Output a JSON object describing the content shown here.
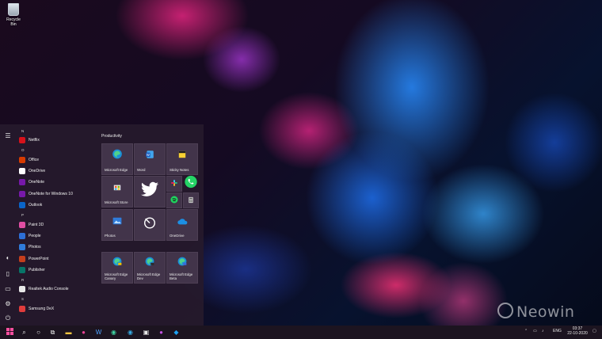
{
  "desktop": {
    "recycle_bin_label": "Recycle Bin",
    "watermark": "Neowin"
  },
  "rail_icons": [
    "hamburger-icon",
    "user-icon",
    "document-icon",
    "pictures-icon",
    "settings-icon",
    "power-icon"
  ],
  "app_list": [
    {
      "type": "letter",
      "text": "N"
    },
    {
      "type": "app",
      "text": "Netflix",
      "color": "#d7121b"
    },
    {
      "type": "letter",
      "text": "O"
    },
    {
      "type": "app",
      "text": "Office",
      "color": "#d83b01"
    },
    {
      "type": "app",
      "text": "OneDrive",
      "color": "#ffffff"
    },
    {
      "type": "app",
      "text": "OneNote",
      "color": "#7719aa"
    },
    {
      "type": "app",
      "text": "OneNote for Windows 10",
      "color": "#7719aa"
    },
    {
      "type": "app",
      "text": "Outlook",
      "color": "#0a64c8"
    },
    {
      "type": "letter",
      "text": "P"
    },
    {
      "type": "app",
      "text": "Paint 3D",
      "color": "#e04ea3"
    },
    {
      "type": "app",
      "text": "People",
      "color": "#2d6fd6"
    },
    {
      "type": "app",
      "text": "Photos",
      "color": "#2f7bd9"
    },
    {
      "type": "app",
      "text": "PowerPoint",
      "color": "#c43e1c"
    },
    {
      "type": "app",
      "text": "Publisher",
      "color": "#077568"
    },
    {
      "type": "letter",
      "text": "R"
    },
    {
      "type": "app",
      "text": "Realtek Audio Console",
      "color": "#e8e8e8"
    },
    {
      "type": "letter",
      "text": "S"
    },
    {
      "type": "app",
      "text": "Samsung DeX",
      "color": "#e03c3c"
    }
  ],
  "tiles": {
    "group_productivity": "Productivity",
    "edge": "Microsoft Edge",
    "word": "Word",
    "sticky_notes": "Sticky Notes",
    "store": "Microsoft Store",
    "photos": "Photos",
    "onedrive": "OneDrive",
    "edge_canary": "Microsoft Edge Canary",
    "edge_dev": "Microsoft Edge Dev",
    "edge_beta": "Microsoft Edge Beta"
  },
  "taskbar": {
    "language": "ENG",
    "time": "03:37",
    "date": "22-10-2020"
  }
}
